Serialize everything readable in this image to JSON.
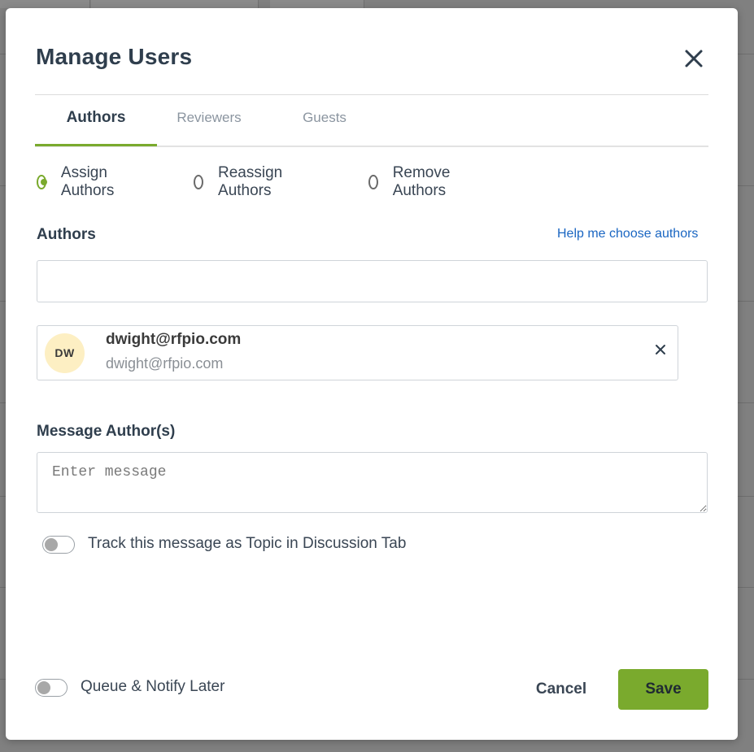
{
  "modal": {
    "title": "Manage Users",
    "close_icon": "close-icon"
  },
  "tabs": [
    {
      "label": "Authors",
      "active": true
    },
    {
      "label": "Reviewers",
      "active": false
    },
    {
      "label": "Guests",
      "active": false
    }
  ],
  "mode_options": [
    {
      "label": "Assign Authors",
      "checked": true
    },
    {
      "label": "Reassign Authors",
      "checked": false
    },
    {
      "label": "Remove Authors",
      "checked": false
    }
  ],
  "authors": {
    "label": "Authors",
    "help_link": "Help me choose authors",
    "input_value": "",
    "selected": [
      {
        "initials": "DW",
        "name": "dwight@rfpio.com",
        "email": "dwight@rfpio.com",
        "avatar_color": "#fdefc3"
      }
    ]
  },
  "message": {
    "label": "Message Author(s)",
    "placeholder": "Enter message",
    "value": ""
  },
  "track_toggle": {
    "label": "Track this message as Topic in Discussion Tab",
    "on": false
  },
  "footer": {
    "queue_toggle_label": "Queue & Notify Later",
    "queue_on": false,
    "cancel_label": "Cancel",
    "save_label": "Save"
  },
  "colors": {
    "accent": "#7aaa2d",
    "link": "#1a66c2",
    "title": "#2f3e4d"
  }
}
